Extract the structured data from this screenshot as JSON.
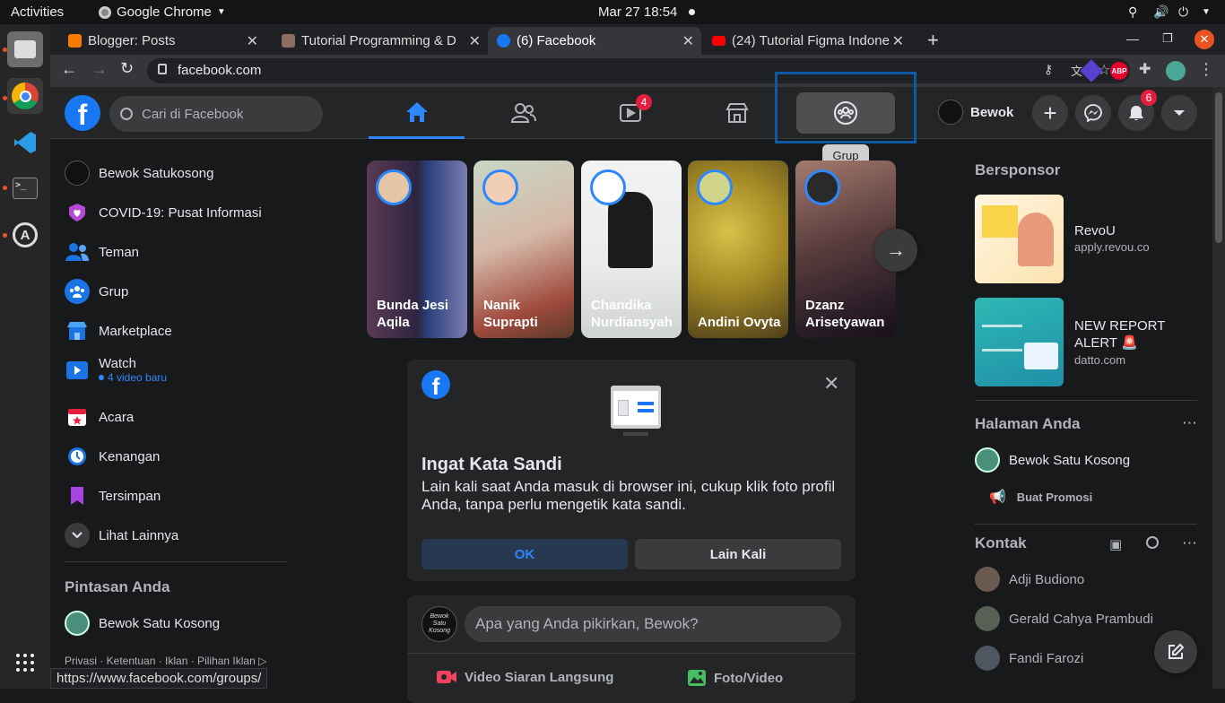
{
  "os": {
    "activities": "Activities",
    "app_name": "Google Chrome",
    "datetime": "Mar 27  18:54"
  },
  "browser": {
    "tabs": [
      {
        "title": "Blogger: Posts",
        "color": "#f57c00"
      },
      {
        "title": "Tutorial Programming & D",
        "color": "#8d6e63"
      },
      {
        "title": "(6) Facebook",
        "color": "#1877f2"
      },
      {
        "title": "(24) Tutorial Figma Indone",
        "color": "#ff0000"
      }
    ],
    "url": "facebook.com",
    "status_url": "https://www.facebook.com/groups/",
    "abp_label": "ABP"
  },
  "fb": {
    "search_placeholder": "Cari di Facebook",
    "watch_badge": "4",
    "notif_badge": "6",
    "profile_name": "Bewok",
    "tooltip": "Grup",
    "left_nav": [
      {
        "label": "Bewok Satukosong",
        "icon": "avatar-icon"
      },
      {
        "label": "COVID-19: Pusat Informasi",
        "icon": "covid-heart-icon"
      },
      {
        "label": "Teman",
        "icon": "friends-icon"
      },
      {
        "label": "Grup",
        "icon": "groups-icon"
      },
      {
        "label": "Marketplace",
        "icon": "marketplace-icon"
      },
      {
        "label": "Watch",
        "icon": "watch-icon"
      },
      {
        "label": "Acara",
        "icon": "events-icon"
      },
      {
        "label": "Kenangan",
        "icon": "memories-icon"
      },
      {
        "label": "Tersimpan",
        "icon": "saved-icon"
      },
      {
        "label": "Lihat Lainnya",
        "icon": "chevron-down-icon"
      }
    ],
    "watch_sub": "4 video baru",
    "shortcuts_title": "Pintasan Anda",
    "shortcut": "Bewok Satu Kosong",
    "footer": "Privasi · Ketentuan · Iklan · Pilihan Iklan",
    "stories": [
      {
        "name": "Bunda Jesi Aqila"
      },
      {
        "name": "Nanik Suprapti"
      },
      {
        "name": "Chandika Nurdiansyah"
      },
      {
        "name": "Andini Ovyta"
      },
      {
        "name": "Dzanz Arisetyawan"
      }
    ],
    "dialog": {
      "title": "Ingat Kata Sandi",
      "text": "Lain kali saat Anda masuk di browser ini, cukup klik foto profil Anda, tanpa perlu mengetik kata sandi.",
      "ok": "OK",
      "later": "Lain Kali"
    },
    "composer": {
      "placeholder": "Apa yang Anda pikirkan, Bewok?",
      "live": "Video Siaran Langsung",
      "photo": "Foto/Video",
      "avatar_text": "Bewok\nSatu Kosong"
    },
    "right": {
      "sponsored": "Bersponsor",
      "ads": [
        {
          "name": "RevoU",
          "domain": "apply.revou.co"
        },
        {
          "name": "NEW REPORT ALERT 🚨",
          "domain": "datto.com"
        }
      ],
      "pages_title": "Halaman Anda",
      "page_name": "Bewok Satu Kosong",
      "promote": "Buat Promosi",
      "contacts_title": "Kontak",
      "contacts": [
        "Adji Budiono",
        "Gerald Cahya Prambudi",
        "Fandi Farozi"
      ]
    }
  }
}
